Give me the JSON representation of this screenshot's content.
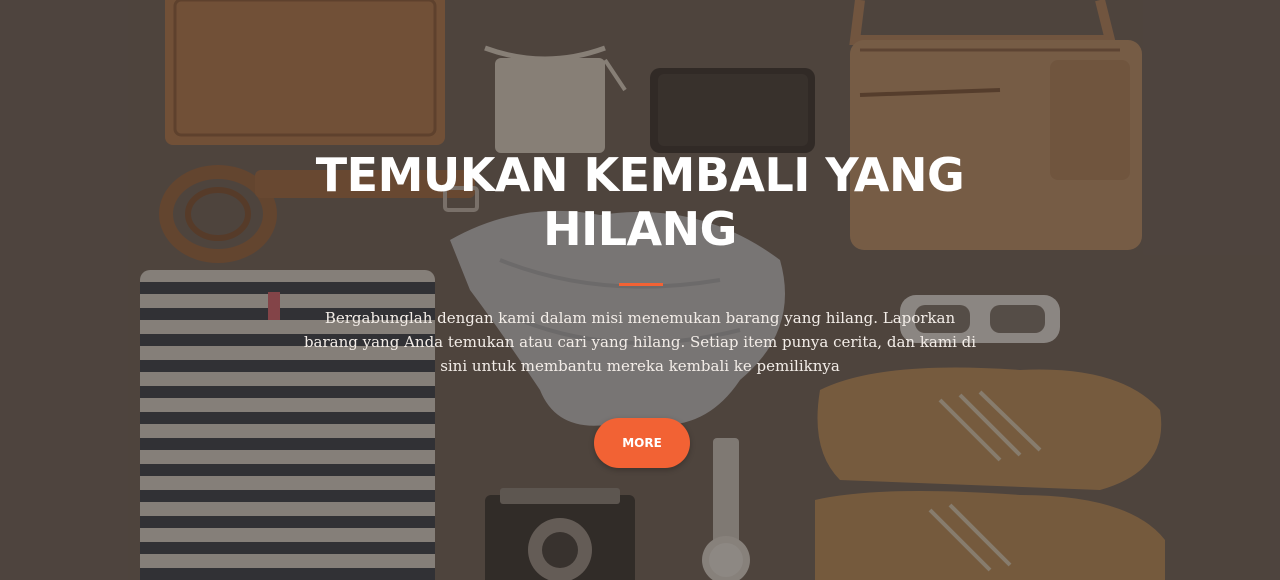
{
  "hero": {
    "title": "TEMUKAN KEMBALI YANG HILANG",
    "description": "Bergabunglah dengan kami dalam misi menemukan barang yang hilang. Laporkan barang yang Anda temukan atau cari yang hilang. Setiap item punya cerita, dan kami di sini untuk membantu mereka kembali ke pemiliknya",
    "button_label": "MORE"
  },
  "colors": {
    "accent": "#f26234",
    "overlay": "rgba(55,45,40,0.55)",
    "text": "#ffffff"
  },
  "background_items": [
    "leather-folio-icon",
    "belt-icon",
    "pouch-icon",
    "smartphone-icon",
    "shoulder-bag-icon",
    "scarf-icon",
    "sunglasses-icon",
    "striped-shirt-icon",
    "boots-icon",
    "camera-icon",
    "wristwatch-icon"
  ]
}
